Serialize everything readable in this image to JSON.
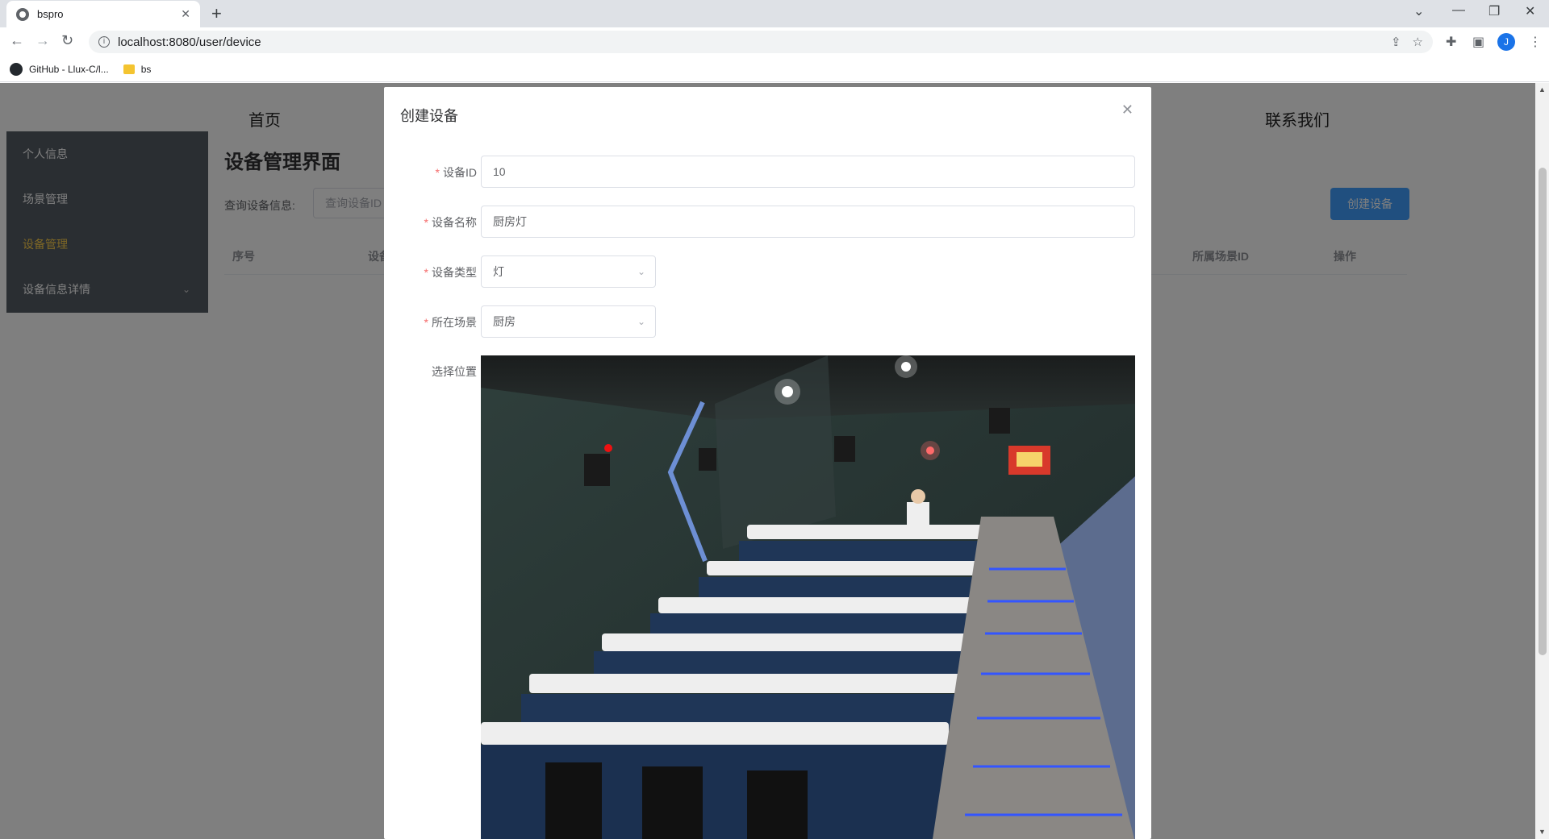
{
  "browser": {
    "tab_title": "bspro",
    "url": "localhost:8080/user/device",
    "avatar_letter": "J",
    "bookmarks": [
      {
        "label": "GitHub - Llux-C/l..."
      },
      {
        "label": "bs"
      }
    ]
  },
  "topnav": {
    "home": "首页",
    "contact": "联系我们"
  },
  "sidebar": {
    "items": [
      {
        "label": "个人信息"
      },
      {
        "label": "场景管理"
      },
      {
        "label": "设备管理"
      },
      {
        "label": "设备信息详情"
      }
    ]
  },
  "main": {
    "title": "设备管理界面",
    "search_label": "查询设备信息:",
    "search_placeholder": "查询设备ID",
    "create_button": "创建设备",
    "columns": [
      "序号",
      "设备",
      "所属场景ID",
      "操作"
    ]
  },
  "dialog": {
    "title": "创建设备",
    "fields": {
      "device_id": {
        "label": "设备ID",
        "value": "10"
      },
      "device_name": {
        "label": "设备名称",
        "value": "厨房灯"
      },
      "device_type": {
        "label": "设备类型",
        "value": "灯"
      },
      "scene": {
        "label": "所在场景",
        "value": "厨房"
      },
      "location": {
        "label": "选择位置"
      }
    }
  }
}
